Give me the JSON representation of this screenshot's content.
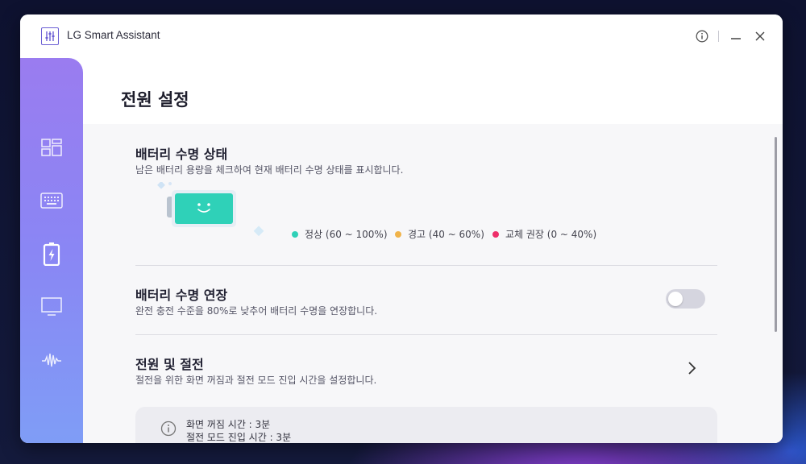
{
  "app": {
    "title": "LG Smart Assistant"
  },
  "titlebar": {
    "info_icon": "info-icon",
    "minimize_icon": "minimize-icon",
    "close_icon": "close-icon"
  },
  "sidebar": {
    "items": [
      {
        "icon": "dashboard-icon",
        "active": false
      },
      {
        "icon": "keyboard-icon",
        "active": false
      },
      {
        "icon": "battery-charging-icon",
        "active": true
      },
      {
        "icon": "monitor-icon",
        "active": false
      },
      {
        "icon": "audio-wave-icon",
        "active": false
      }
    ]
  },
  "page": {
    "title": "전원 설정"
  },
  "battery_health": {
    "title": "배터리 수명 상태",
    "description": "남은 배터리 용량을 체크하여 현재 배터리 수명 상태를 표시합니다.",
    "status_color": "#2fd1b8",
    "legend": [
      {
        "label": "정상 (60 ~ 100%)",
        "color": "#2fd1b8"
      },
      {
        "label": "경고 (40 ~ 60%)",
        "color": "#f0b34a"
      },
      {
        "label": "교체 권장 (0 ~ 40%)",
        "color": "#ee2f6a"
      }
    ]
  },
  "battery_extend": {
    "title": "배터리 수명 연장",
    "description": "완전 충전 수준을 80%로 낮추어 배터리 수명을 연장합니다.",
    "enabled": false
  },
  "power_saving": {
    "title": "전원 및 절전",
    "description": "절전을 위한 화면 꺼짐과 절전 모드 진입 시간을 설정합니다.",
    "info_lines": [
      "화면 꺼짐 시간  : 3분",
      "절전 모드 진입 시간  : 3분"
    ]
  }
}
